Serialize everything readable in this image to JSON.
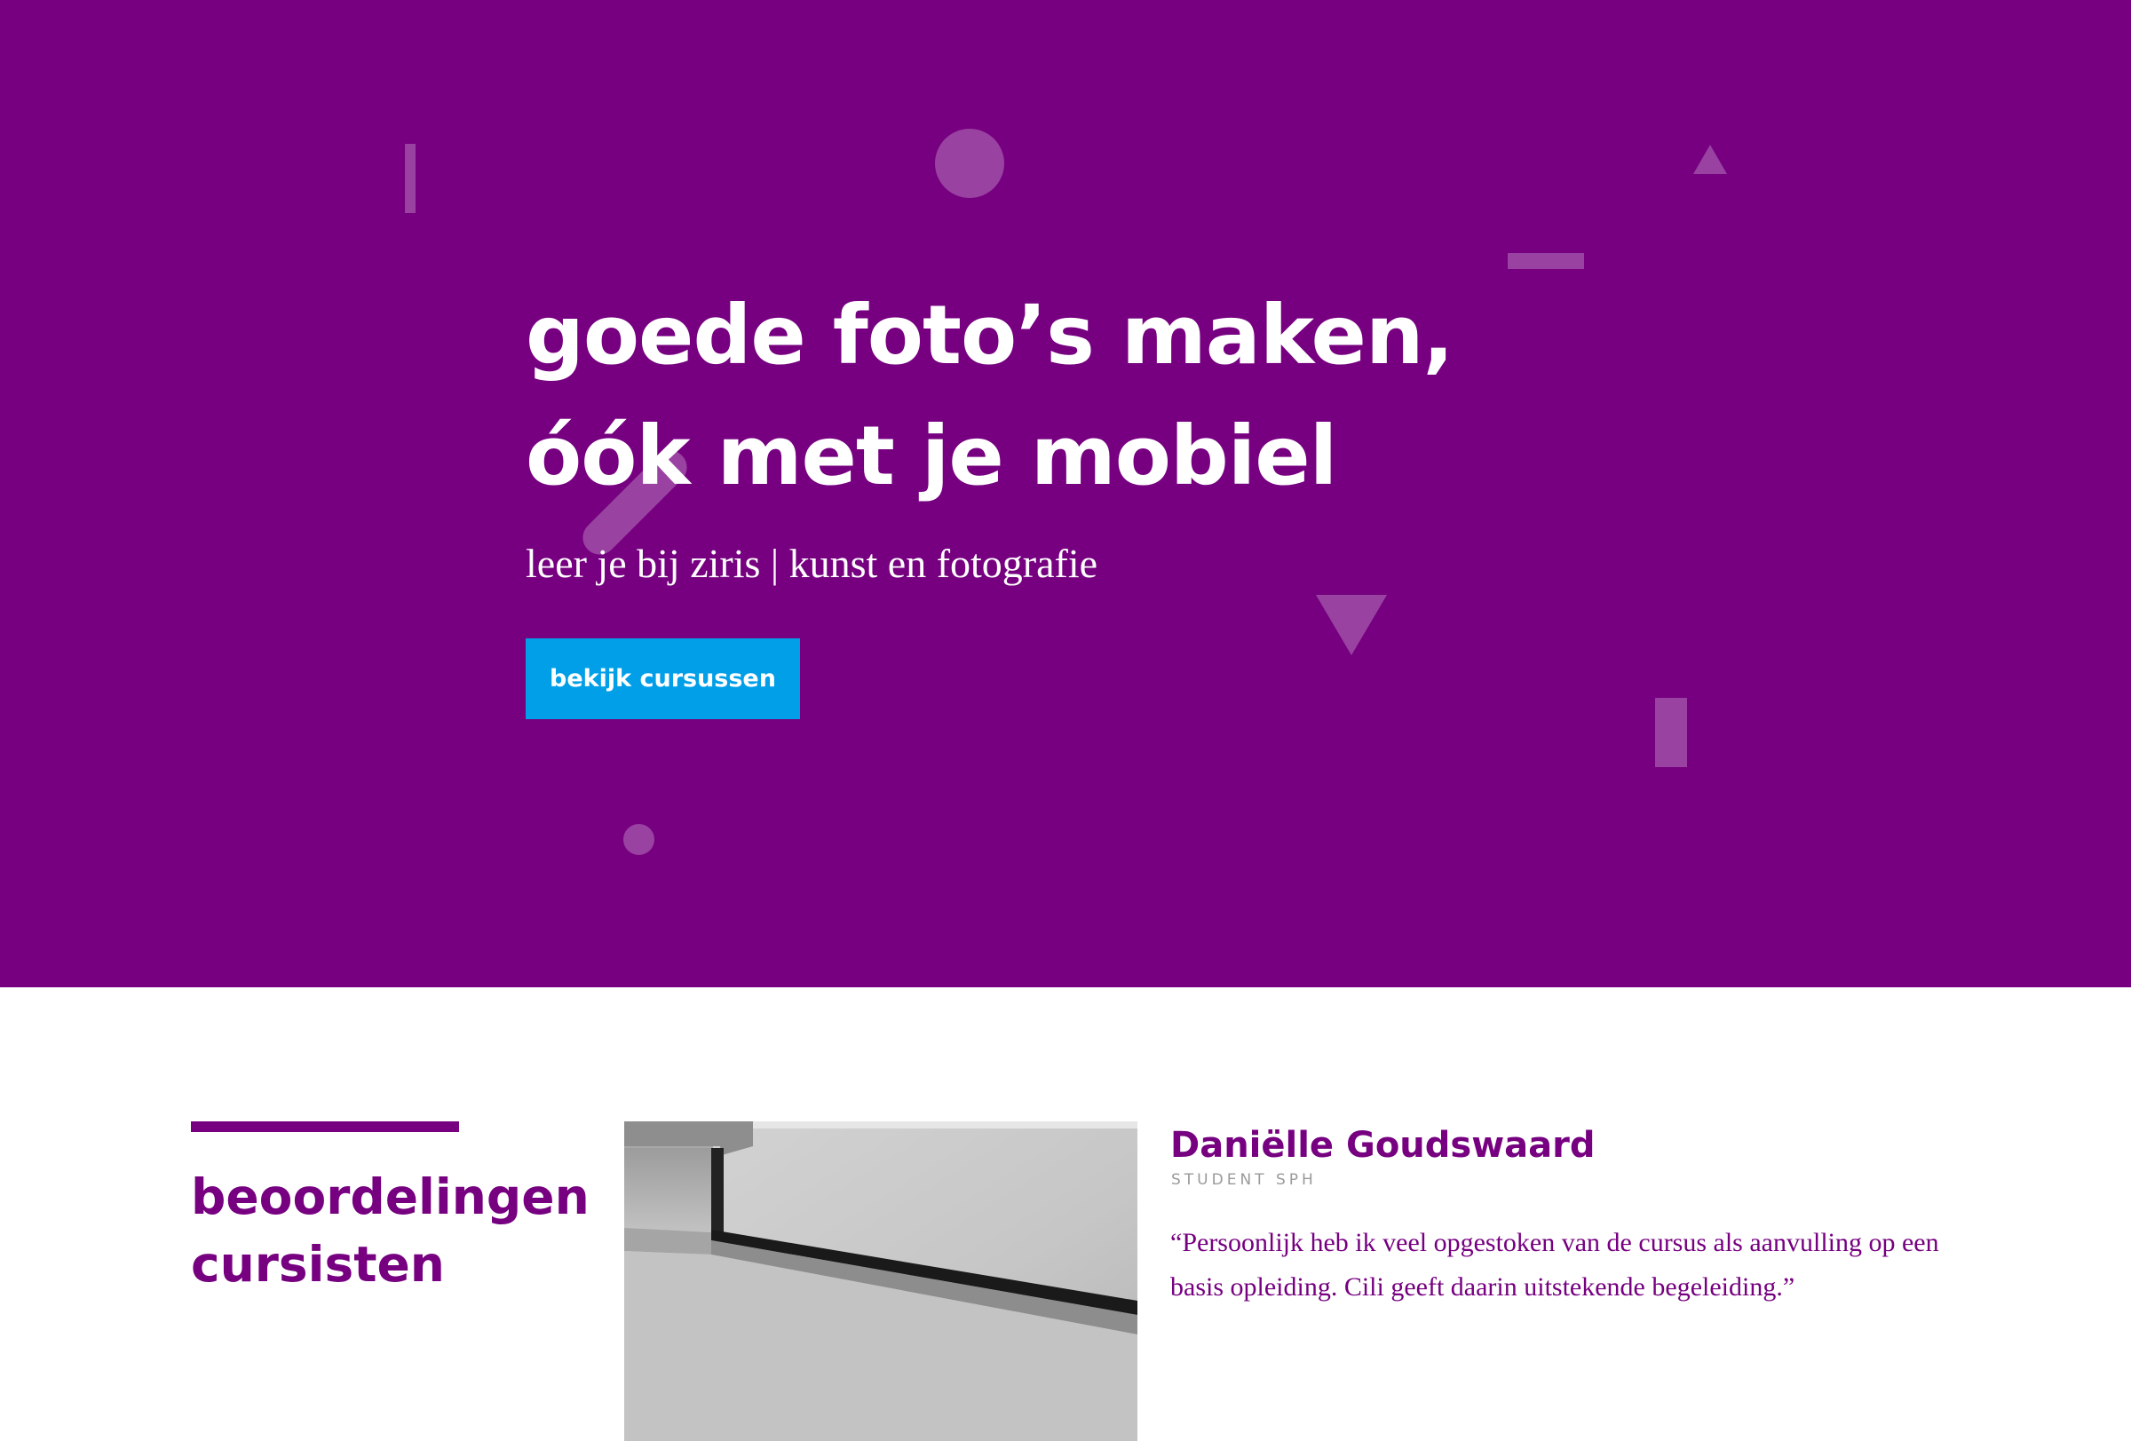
{
  "colors": {
    "hero_background": "#760080",
    "button_background": "#009fe8",
    "accent_purple": "#760080",
    "role_gray": "#9a9a9a"
  },
  "hero": {
    "title_line1": "goede foto’s maken,",
    "title_line2": "óók met je mobiel",
    "subtitle": "leer je bij ziris | kunst en fotografie",
    "cta_label": "bekijk cursussen"
  },
  "reviews": {
    "heading_line1": "beoordelingen",
    "heading_line2": "cursisten",
    "items": [
      {
        "name": "Daniëlle Goudswaard",
        "role": "STUDENT SPH",
        "quote": "“Persoonlijk heb ik veel opgestoken van de cursus als aanvulling op een basis opleiding. Cili geeft daarin uitstekende begeleiding.”"
      }
    ]
  }
}
